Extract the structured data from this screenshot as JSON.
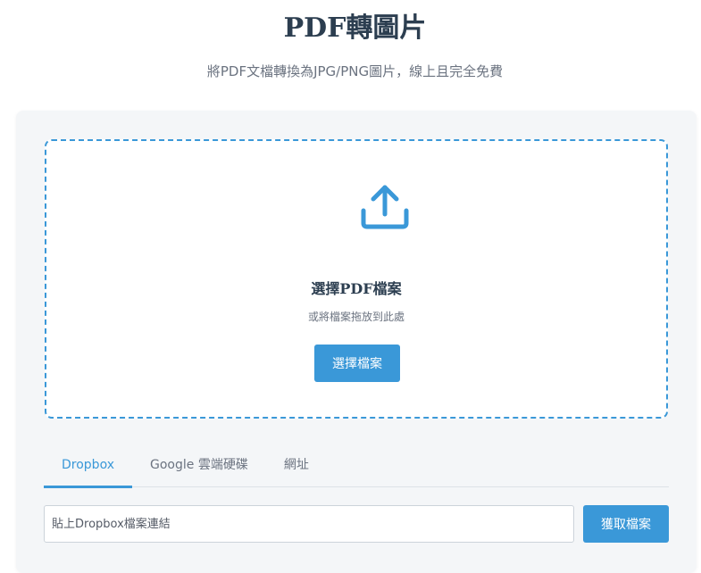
{
  "header": {
    "title": "PDF轉圖片",
    "subtitle": "將PDF文檔轉換為JPG/PNG圖片，線上且完全免費"
  },
  "dropzone": {
    "icon": "upload-icon",
    "title": "選擇PDF檔案",
    "hint": "或將檔案拖放到此處",
    "button_label": "選擇檔案"
  },
  "tabs": [
    {
      "label": "Dropbox",
      "active": true
    },
    {
      "label": "Google 雲端硬碟",
      "active": false
    },
    {
      "label": "網址",
      "active": false
    }
  ],
  "url_form": {
    "placeholder": "貼上Dropbox檔案連結",
    "value": "",
    "button_label": "獲取檔案"
  },
  "colors": {
    "accent": "#3a98d8",
    "title": "#2c3e50",
    "muted": "#6b7380",
    "card_bg": "#f4f6f8"
  }
}
